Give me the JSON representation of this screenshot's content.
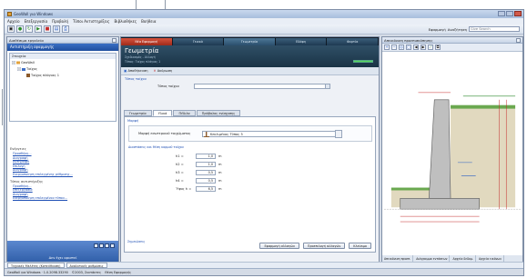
{
  "window": {
    "title": "GeoWall για Windows"
  },
  "menu": [
    "Αρχείο",
    "Επεξεργασία",
    "Προβολή",
    "Τύποι Αντιστηρίξεις",
    "Βιβλιοθήκες",
    "Βοήθεια"
  ],
  "search": {
    "label": "Εφαρμογή",
    "label2": "Αναζήτηση",
    "placeholder": "Give Search"
  },
  "left_panel": {
    "caption": "Διαθέσιμα εργαλεία",
    "header": "Αντιστήριξη εφαρμογής",
    "tree_caption": "Στοιχεία",
    "tree": [
      "GeoWall",
      "Τοίχος",
      "Τοίχος πλάγιας 1"
    ],
    "links_caption_1": "Ενέργειες",
    "links_1": [
      "Προσθήκη...",
      "Διαγραφή",
      "Αντιγραφή",
      "Επιλογή",
      "Διαγραφή",
      "Ενεργοποίηση επιλεγμένης ρύθμισης..."
    ],
    "links_caption_2": "Τύπος αντιστήριξης",
    "links_2": [
      "Προσθήκη...",
      "Επεξεργασία",
      "Διαγραφή",
      "Ενεργοποίηση επιλεγμένου τύπου..."
    ],
    "bottom_label": "Δεν έχει οριστεί"
  },
  "document": {
    "tabs": [
      "Νέα Εφαρμογή",
      "Γενικά",
      "Γεωμετρία",
      "Εδάφη",
      "Φορτία"
    ],
    "hero_title": "Γεωμετρία",
    "hero_line1": "Σχεδιασμός - Αλλαγή",
    "hero_line2": "Τύπος: Τοίχος πλάγιας 1",
    "progress": 1.0,
    "actions": [
      "Αποθήκευση",
      "Ακύρωση"
    ],
    "section_title": "Τύπος τοίχου",
    "wall_type_label": "Τύπος τοίχου",
    "inner_tabs": [
      "Γεωμετρία",
      "Υλικά",
      "Πέδιλα",
      "Πρόβολος ενίσχυσης"
    ],
    "panel_caption": "Μορφή",
    "shape_label": "Μορφή εσωτερικού τοιχώματος",
    "shape_value": "Κεκλιμένος Τύπος 3",
    "dims_caption": "Διαστάσεις και θέση κορμού τοίχου",
    "dims": [
      {
        "k": "h1 =",
        "v": "1,0",
        "u": "m"
      },
      {
        "k": "h2 =",
        "v": "1,0",
        "u": "m"
      },
      {
        "k": "h3 =",
        "v": "0,5",
        "u": "m"
      },
      {
        "k": "h4 =",
        "v": "0,5",
        "u": "m"
      },
      {
        "k": "Ύψος h =",
        "v": "6,5",
        "u": "m"
      }
    ],
    "note_caption": "Σημειώσεις",
    "buttons": [
      "Εφαρμογή αλλαγών",
      "Προεπιλογή αλλαγών",
      "Κλείσιμο"
    ]
  },
  "right_panel": {
    "caption": "Απεικόνιση προεπισκόπησης",
    "tabs": [
      "Απεικόνιση προεπ.",
      "Διάγραμμα εντάσεων",
      "Αρχεία δεδομ.",
      "Αρχεία εικόνων"
    ]
  },
  "bottom_tabs": [
    "Τεχνικές Μελέτες (Κατεύθυνση)",
    "Αναλυτικές ρυθμίσεις"
  ],
  "status": {
    "text": "GeoWall για Windows · 1.0.2098.33290",
    "version": "©2003, Συντάκτες",
    "user": "Θέση Εφαρμογής"
  }
}
